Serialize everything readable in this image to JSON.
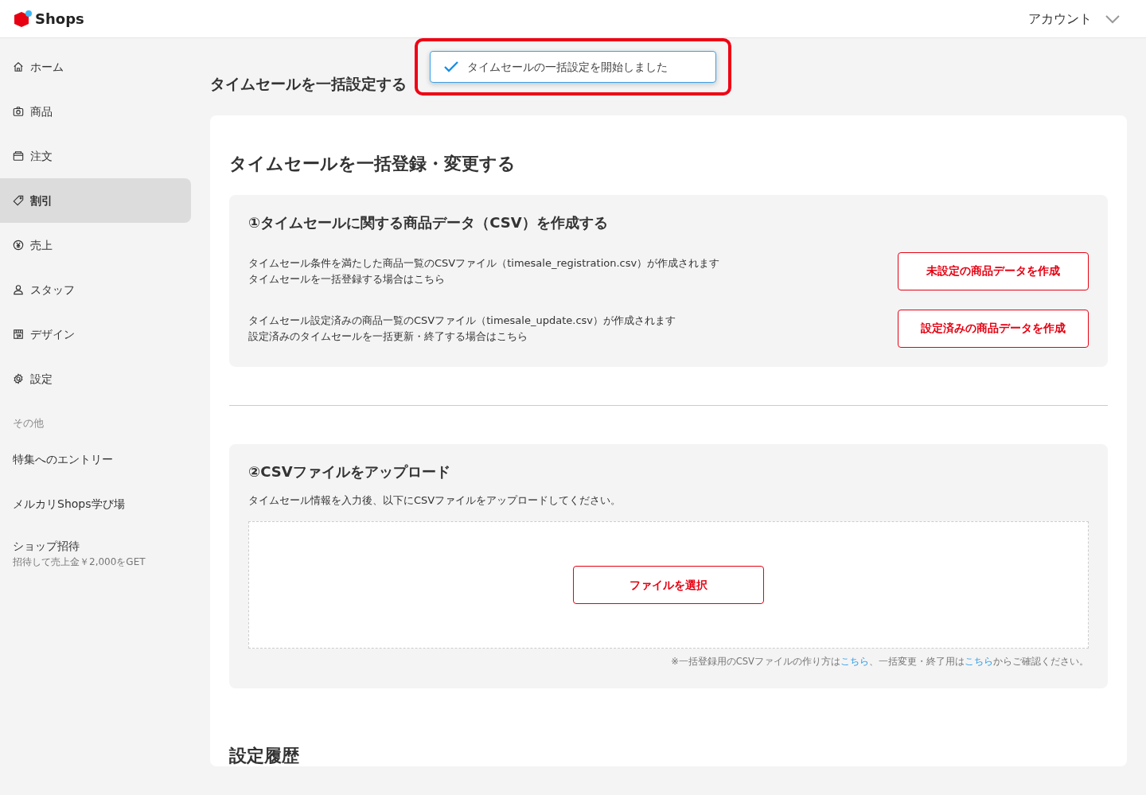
{
  "header": {
    "logo_text": "Shops",
    "account": "アカウント"
  },
  "sidebar": {
    "items": [
      {
        "kind": "nav",
        "label": "ホーム",
        "selected": false
      },
      {
        "kind": "nav",
        "label": "商品",
        "selected": false
      },
      {
        "kind": "nav",
        "label": "注文",
        "selected": false
      },
      {
        "kind": "nav",
        "label": "割引",
        "selected": true
      },
      {
        "kind": "nav",
        "label": "売上",
        "selected": false
      },
      {
        "kind": "nav",
        "label": "スタッフ",
        "selected": false
      },
      {
        "kind": "nav",
        "label": "デザイン",
        "selected": false
      },
      {
        "kind": "nav",
        "label": "設定",
        "selected": false
      },
      {
        "kind": "section",
        "label": "その他"
      },
      {
        "kind": "link",
        "label": "特集へのエントリー"
      },
      {
        "kind": "link",
        "label": "メルカリShops学び場"
      },
      {
        "kind": "promo",
        "label": "ショップ招待",
        "subtitle": "招待して売上金￥2,000をGET"
      }
    ]
  },
  "page_title": "タイムセールを一括設定する",
  "toast": {
    "message": "タイムセールの一括設定を開始しました"
  },
  "card": {
    "title": "タイムセールを一括登録・変更する",
    "step1": {
      "title": "①タイムセールに関する商品データ（CSV）を作成する",
      "rows": [
        {
          "lines": [
            "タイムセール条件を満たした商品一覧のCSVファイル（timesale_registration.csv）が作成されます",
            "タイムセールを一括登録する場合はこちら"
          ],
          "button": "未設定の商品データを作成"
        },
        {
          "lines": [
            "タイムセール設定済みの商品一覧のCSVファイル（timesale_update.csv）が作成されます",
            "設定済みのタイムセールを一括更新・終了する場合はこちら"
          ],
          "button": "設定済みの商品データを作成"
        }
      ]
    },
    "step2": {
      "title": "②CSVファイルをアップロード",
      "description": "タイムセール情報を入力後、以下にCSVファイルをアップロードしてください。",
      "button": "ファイルを選択",
      "footnote": [
        {
          "kind": "text",
          "text": "※一括登録用のCSVファイルの作り方は"
        },
        {
          "kind": "link",
          "text": "こちら"
        },
        {
          "kind": "text",
          "text": "、一括変更・終了用は"
        },
        {
          "kind": "link",
          "text": "こちら"
        },
        {
          "kind": "text",
          "text": "からご確認ください。"
        }
      ]
    },
    "history_title": "設定履歴"
  }
}
